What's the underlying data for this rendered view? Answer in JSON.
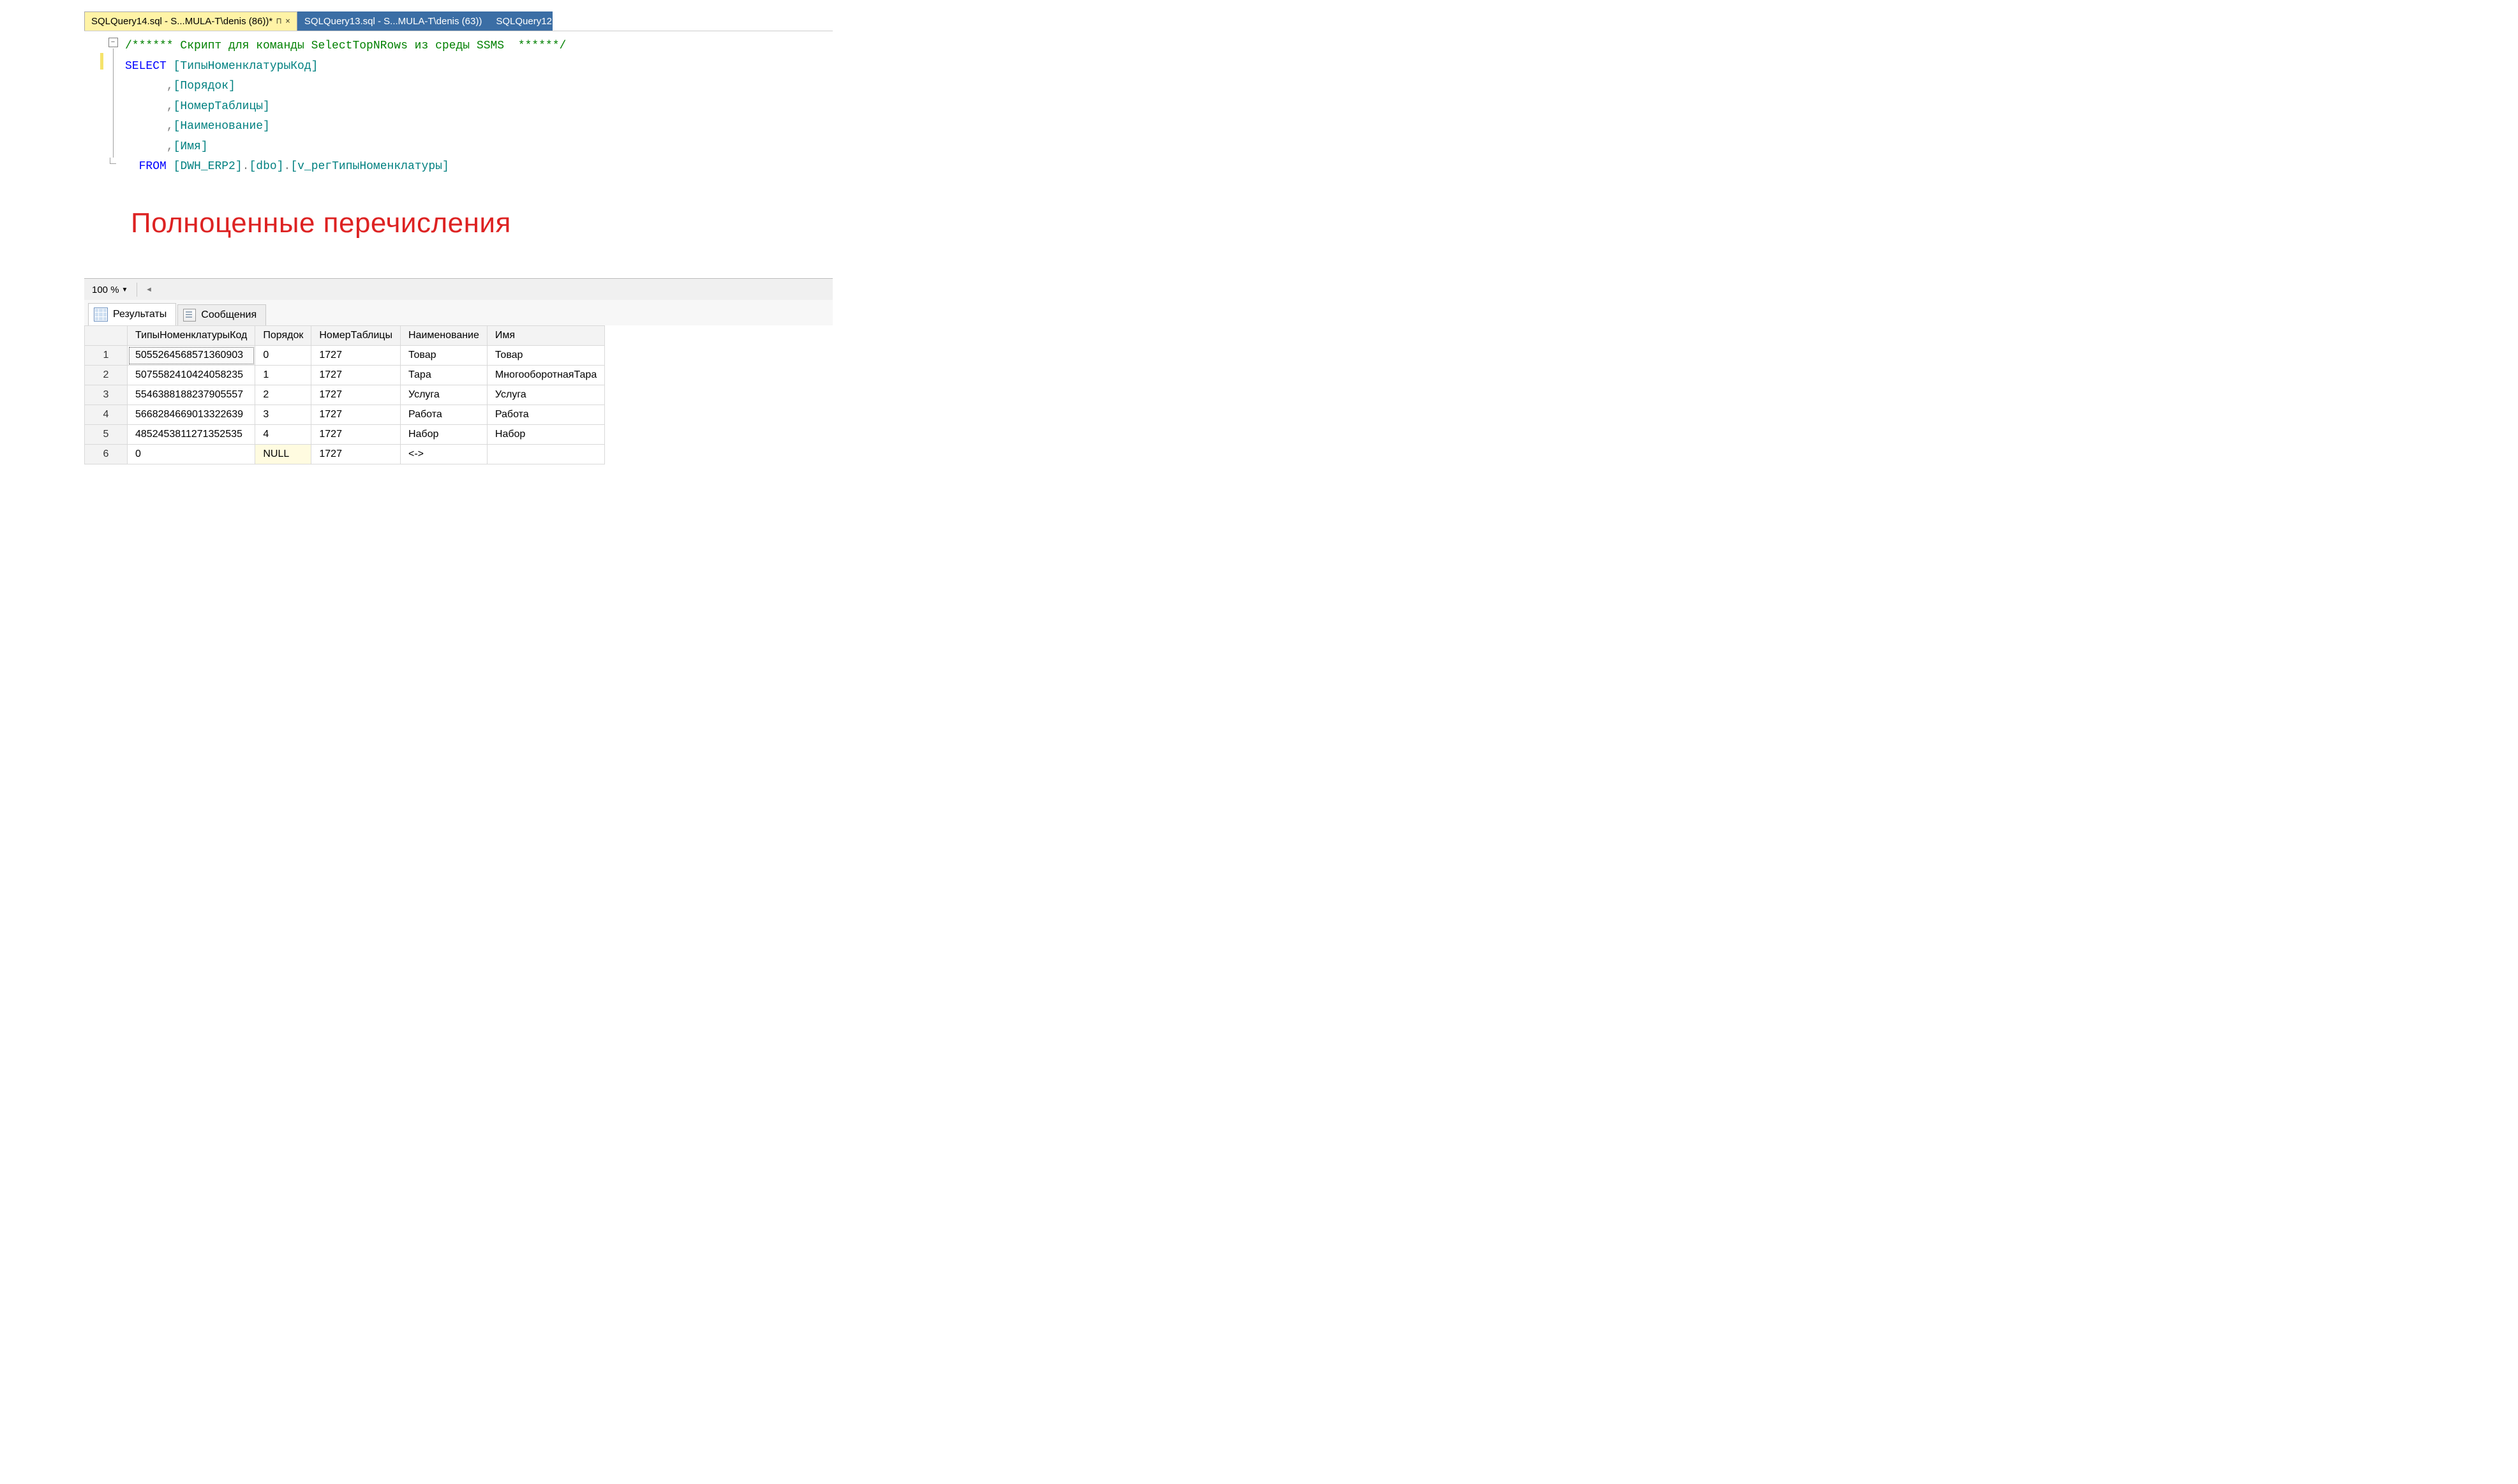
{
  "tabs": {
    "active": {
      "label": "SQLQuery14.sql - S...MULA-T\\denis (86))*",
      "pin": "⊓",
      "close": "×"
    },
    "inactive": {
      "label": "SQLQuery13.sql - S...MULA-T\\denis (63))"
    },
    "partial": {
      "label": "SQLQuery12"
    }
  },
  "code": {
    "comment": "/****** Скрипт для команды SelectTopNRows из среды SSMS  ******/",
    "select": "SELECT",
    "cols": [
      "[ТипыНоменклатурыКод]",
      "[Порядок]",
      "[НомерТаблицы]",
      "[Наименование]",
      "[Имя]"
    ],
    "from": "FROM",
    "src_parts": {
      "db": "[DWH_ERP2]",
      "schema": "[dbo]",
      "obj": "[v_регТипыНоменклатуры]"
    }
  },
  "overlay": "Полноценные перечисления",
  "zoom": {
    "value": "100 %"
  },
  "results_tabs": {
    "results": "Результаты",
    "messages": "Сообщения"
  },
  "grid": {
    "headers": [
      "ТипыНоменклатурыКод",
      "Порядок",
      "НомерТаблицы",
      "Наименование",
      "Имя"
    ],
    "rows": [
      {
        "n": "1",
        "c": [
          "5055264568571360903",
          "0",
          "1727",
          "Товар",
          "Товар"
        ]
      },
      {
        "n": "2",
        "c": [
          "5075582410424058235",
          "1",
          "1727",
          "Тара",
          "МногооборотнаяТара"
        ]
      },
      {
        "n": "3",
        "c": [
          "5546388188237905557",
          "2",
          "1727",
          "Услуга",
          "Услуга"
        ]
      },
      {
        "n": "4",
        "c": [
          "5668284669013322639",
          "3",
          "1727",
          "Работа",
          "Работа"
        ]
      },
      {
        "n": "5",
        "c": [
          "4852453811271352535",
          "4",
          "1727",
          "Набор",
          "Набор"
        ]
      },
      {
        "n": "6",
        "c": [
          "0",
          "NULL",
          "1727",
          "<->",
          ""
        ]
      }
    ],
    "null_cell": {
      "row": 5,
      "col": 1
    }
  }
}
